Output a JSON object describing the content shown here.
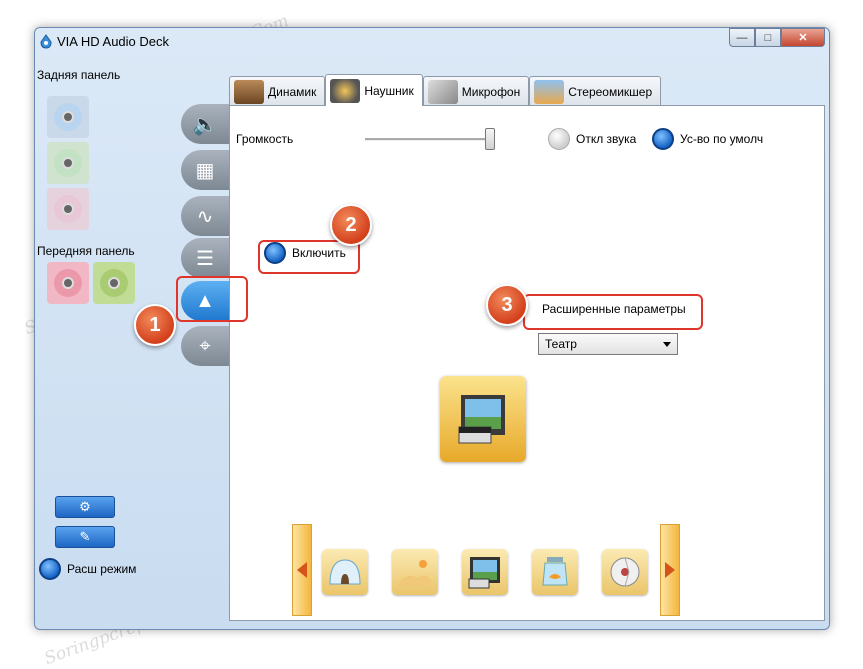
{
  "window": {
    "title": "VIA HD Audio Deck"
  },
  "left_panel": {
    "rear_label": "Задняя панель",
    "front_label": "Передняя панель",
    "adv_mode_label": "Расш режим"
  },
  "tabs": [
    {
      "label": "Динамик"
    },
    {
      "label": "Наушник"
    },
    {
      "label": "Микрофон"
    },
    {
      "label": "Стереомикшер"
    }
  ],
  "content": {
    "volume_label": "Громкость",
    "volume_level": 0.96,
    "mute_label": "Откл звука",
    "default_label": "Ус-во по умолч",
    "enable_label": "Включить",
    "advanced_label": "Расширенные параметры",
    "preset_select": "Театр"
  },
  "badges": [
    "1",
    "2",
    "3"
  ],
  "watermark": "Soringpcrepair.Com",
  "colors": {
    "accent": "#1f78cf",
    "highlight": "#e0352a",
    "badge": "#d3401c"
  }
}
